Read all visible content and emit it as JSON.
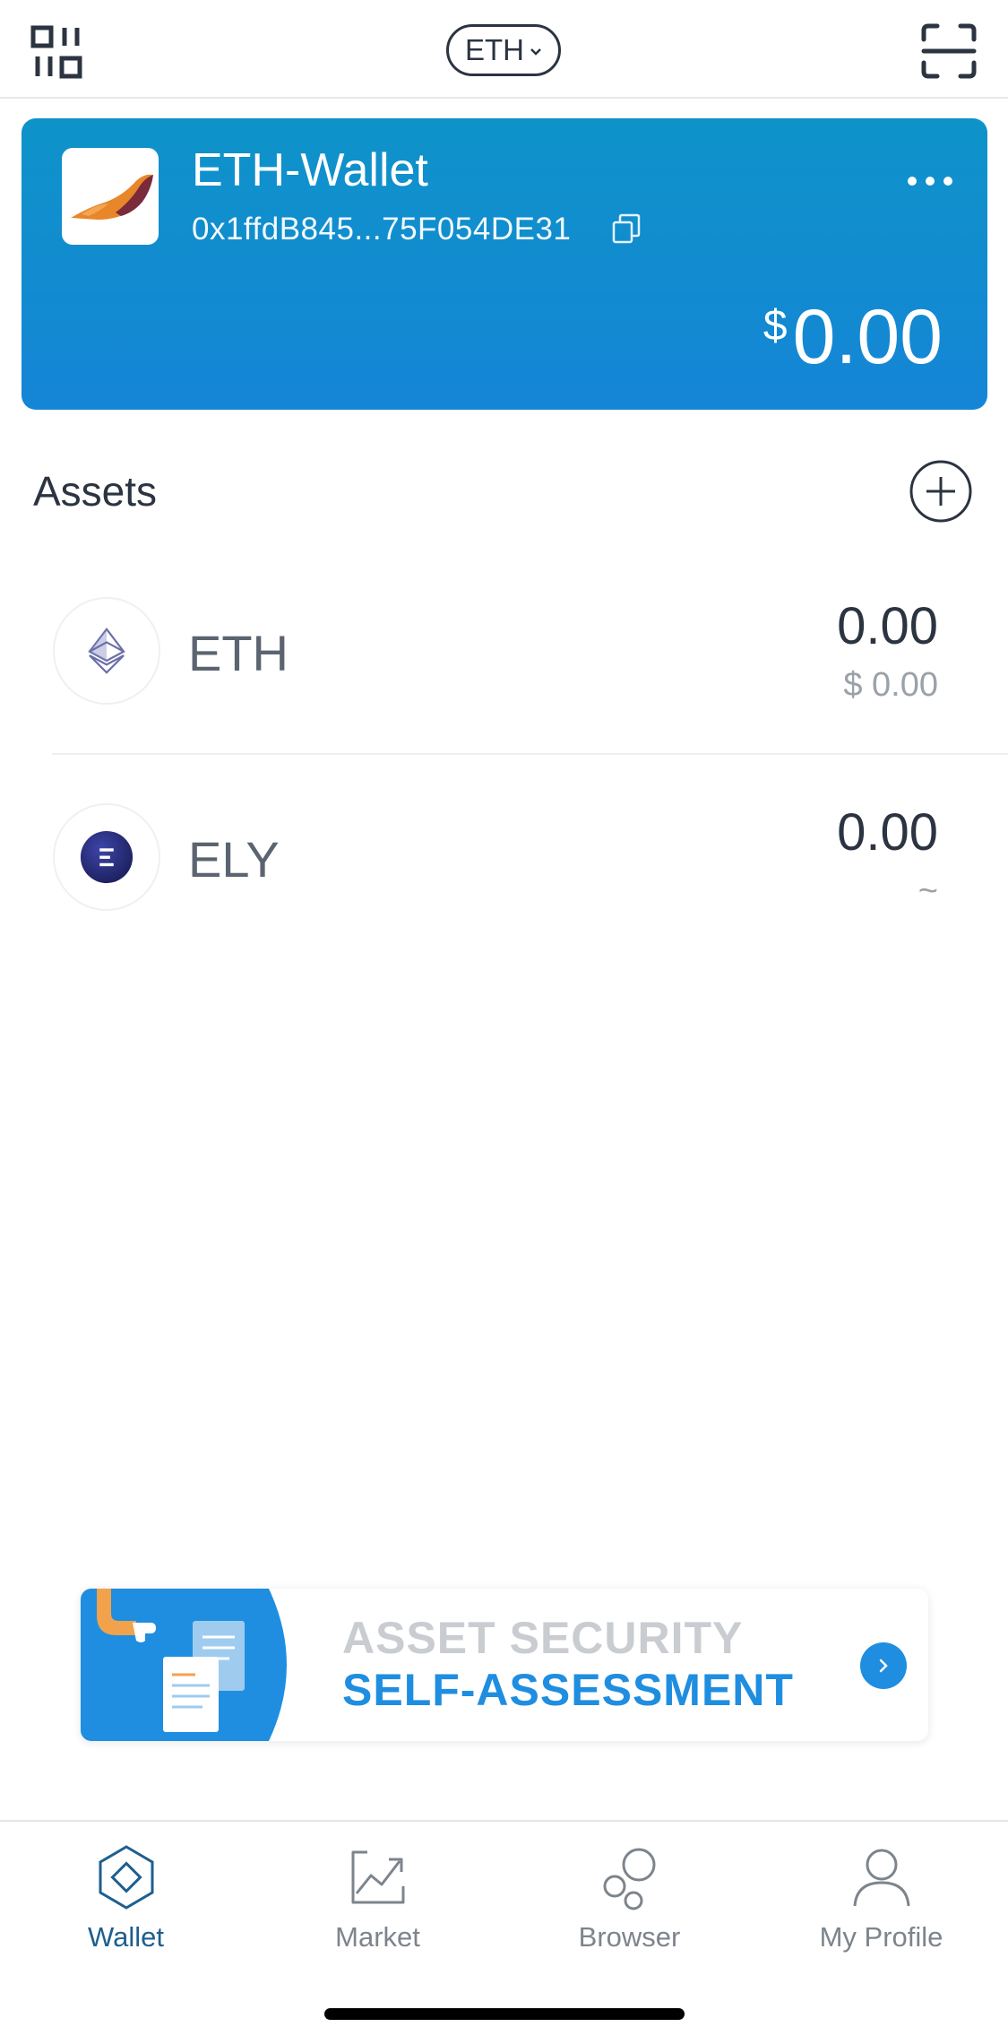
{
  "header": {
    "chain_label": "ETH"
  },
  "wallet": {
    "name": "ETH-Wallet",
    "address": "0x1ffdB845...75F054DE31",
    "balance_currency": "$",
    "balance_amount": "0.00"
  },
  "assets": {
    "title": "Assets",
    "items": [
      {
        "symbol": "ETH",
        "amount": "0.00",
        "fiat": "$ 0.00"
      },
      {
        "symbol": "ELY",
        "amount": "0.00",
        "fiat": "~"
      }
    ]
  },
  "banner": {
    "line1": "ASSET SECURITY",
    "line2": "SELF-ASSESSMENT"
  },
  "tabs": [
    {
      "label": "Wallet",
      "active": true
    },
    {
      "label": "Market",
      "active": false
    },
    {
      "label": "Browser",
      "active": false
    },
    {
      "label": "My Profile",
      "active": false
    }
  ],
  "colors": {
    "card_gradient_top": "#0e93c9",
    "card_gradient_bottom": "#1585d6",
    "accent_blue": "#1f8ee0",
    "active_tab": "#1d5f8f",
    "ely_coin": "#2b2f7a"
  },
  "icons": {
    "top_left": "qr-code-icon",
    "top_right": "scan-icon",
    "copy": "copy-icon",
    "more": "more-dots-icon",
    "add": "plus-circle-icon"
  }
}
